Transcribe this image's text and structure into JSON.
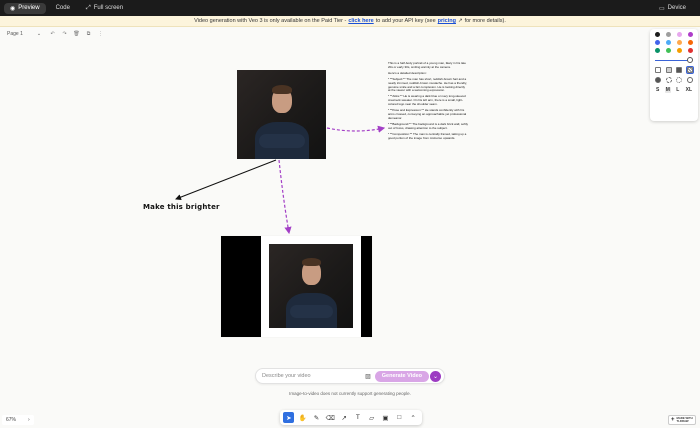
{
  "topbar": {
    "tabs": [
      {
        "label": "Preview",
        "icon": "eye-icon",
        "active": true
      },
      {
        "label": "Code",
        "icon": "code-icon",
        "active": false
      },
      {
        "label": "Full screen",
        "icon": "expand-icon",
        "active": false
      }
    ],
    "device_label": "Device"
  },
  "banner": {
    "text_1": "Video generation with Veo 3 is only available on the Paid Tier -",
    "link_1": "click here",
    "text_2": "to add your API key (see",
    "link_2": "pricing",
    "text_3": "for more details)."
  },
  "pagebar": {
    "page_label": "Page 1"
  },
  "style_panel": {
    "colors": [
      "#1d1d1d",
      "#9e9e9e",
      "#e7a8ee",
      "#ae3ec9",
      "#4263eb",
      "#4dabf7",
      "#ffa94d",
      "#f76707",
      "#099268",
      "#40c057",
      "#f59f00",
      "#e03131"
    ],
    "size_options": [
      "S",
      "M",
      "L",
      "XL"
    ],
    "selected_size": "M",
    "stroke_level": 0.98
  },
  "description": {
    "paragraphs": [
      "This is a half-body portrait of a young man, likely in his late 20s or early 30s, smiling warmly at the camera.",
      "Here's a detailed description:",
      "* **Subject:** The man has short, reddish-brown hair and a neatly trimmed, reddish-brown mustache. He has a friendly, genuine smile and a fair complexion. He is looking directly at the viewer with a welcoming expression.",
      "* **Attire:** He is wearing a dark blue or navy long-sleeved crewneck sweater. On his left arm, there is a small, light-colored logo near the shoulder seam.",
      "* **Pose and Expression:** He stands confidently with his arms crossed, conveying an approachable yet professional demeanor.",
      "* **Background:** The background is a dark brick wall, softly out of focus, drawing attention to the subject.",
      "* **Composition:** The man is centrally framed, taking up a good portion of the image from mid-torso upwards."
    ]
  },
  "annotation": {
    "text": "Make this brighter"
  },
  "prompt": {
    "placeholder": "Describe your video",
    "generate_label": "Generate Video",
    "hint": "Image-to-video does not currently support generating people."
  },
  "tools": [
    {
      "name": "select-tool",
      "glyph": "➤",
      "active": true
    },
    {
      "name": "hand-tool",
      "glyph": "✋",
      "active": false
    },
    {
      "name": "draw-tool",
      "glyph": "✎",
      "active": false
    },
    {
      "name": "eraser-tool",
      "glyph": "⌫",
      "active": false
    },
    {
      "name": "arrow-tool",
      "glyph": "↗",
      "active": false
    },
    {
      "name": "text-tool",
      "glyph": "T",
      "active": false
    },
    {
      "name": "note-tool",
      "glyph": "▱",
      "active": false
    },
    {
      "name": "image-tool",
      "glyph": "▣",
      "active": false
    },
    {
      "name": "rectangle-tool",
      "glyph": "□",
      "active": false
    },
    {
      "name": "more-tools",
      "glyph": "⌃",
      "active": false
    }
  ],
  "zoom": {
    "level": "67%"
  },
  "madewith": {
    "line_1": "MADE WITH",
    "line_2": "TLDRAW"
  }
}
